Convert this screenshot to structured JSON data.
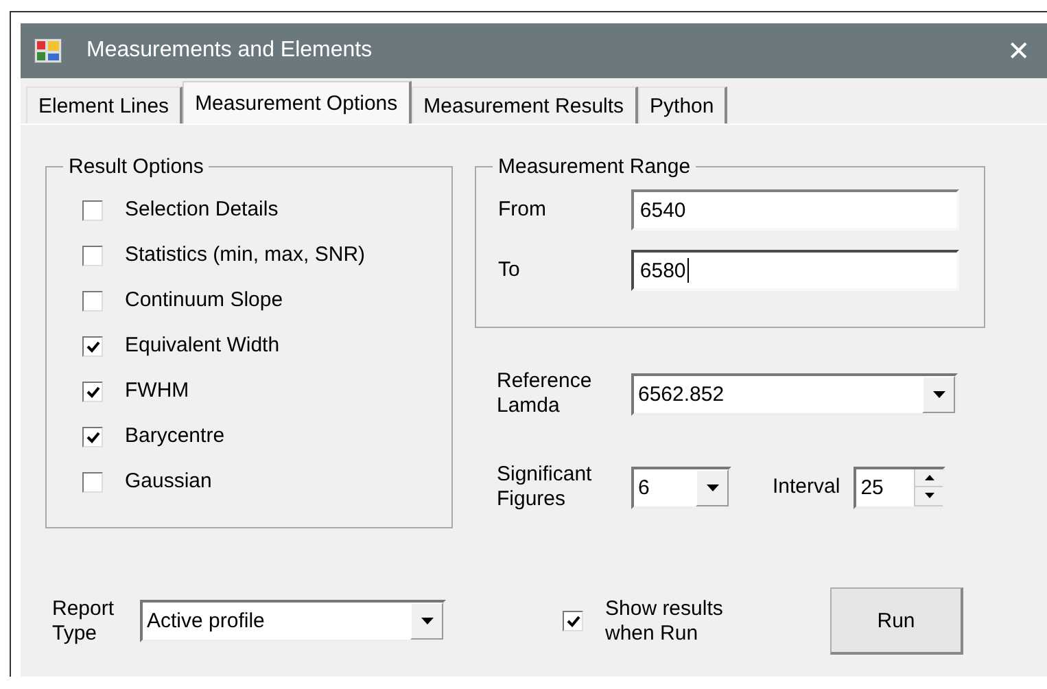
{
  "window": {
    "title": "Measurements and Elements",
    "close": "✕"
  },
  "tabs": [
    {
      "label": "Element Lines",
      "selected": false
    },
    {
      "label": "Measurement Options",
      "selected": true
    },
    {
      "label": "Measurement Results",
      "selected": false
    },
    {
      "label": "Python",
      "selected": false
    }
  ],
  "result_options": {
    "title": "Result Options",
    "items": [
      {
        "label": "Selection Details",
        "checked": false
      },
      {
        "label": "Statistics (min, max, SNR)",
        "checked": false
      },
      {
        "label": "Continuum Slope",
        "checked": false
      },
      {
        "label": "Equivalent Width",
        "checked": true
      },
      {
        "label": "FWHM",
        "checked": true
      },
      {
        "label": "Barycentre",
        "checked": true
      },
      {
        "label": "Gaussian",
        "checked": false
      }
    ]
  },
  "measurement_range": {
    "title": "Measurement Range",
    "fields": [
      {
        "label": "From",
        "value": "6540",
        "focused": false
      },
      {
        "label": "To",
        "value": "6580",
        "focused": true
      }
    ]
  },
  "reference_lamda": {
    "label": "Reference Lamda",
    "value": "6562.852"
  },
  "significant_figures": {
    "label": "Significant Figures",
    "value": "6"
  },
  "interval": {
    "label": "Interval",
    "value": "25"
  },
  "report_type": {
    "label": "Report Type",
    "value": "Active profile"
  },
  "show_results": {
    "label": "Show results when Run",
    "checked": true
  },
  "run_button": "Run"
}
